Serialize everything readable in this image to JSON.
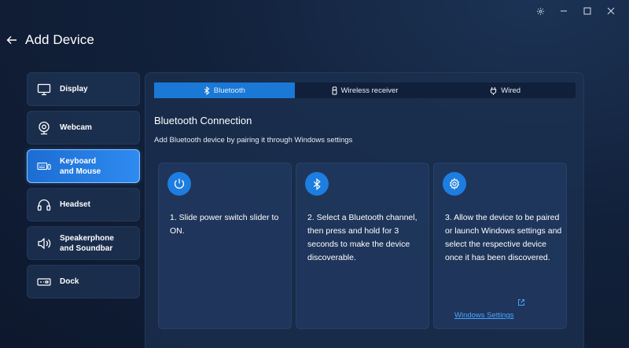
{
  "window": {
    "settings_icon": "gear-icon",
    "minimize_icon": "minimize-icon",
    "maximize_icon": "maximize-icon",
    "close_icon": "close-icon"
  },
  "header": {
    "title": "Add Device",
    "back_icon": "arrow-left-icon"
  },
  "sidebar": {
    "items": [
      {
        "label": "Display",
        "icon": "monitor-icon",
        "active": false
      },
      {
        "label": "Webcam",
        "icon": "webcam-icon",
        "active": false
      },
      {
        "label": "Keyboard\nand Mouse",
        "icon": "keyboard-mouse-icon",
        "active": true
      },
      {
        "label": "Headset",
        "icon": "headset-icon",
        "active": false
      },
      {
        "label": "Speakerphone\nand Soundbar",
        "icon": "speaker-icon",
        "active": false
      },
      {
        "label": "Dock",
        "icon": "dock-icon",
        "active": false
      }
    ]
  },
  "tabs": [
    {
      "label": "Bluetooth",
      "icon": "bluetooth-icon",
      "active": true
    },
    {
      "label": "Wireless receiver",
      "icon": "usb-receiver-icon",
      "active": false
    },
    {
      "label": "Wired",
      "icon": "plug-icon",
      "active": false
    }
  ],
  "main": {
    "section_title": "Bluetooth Connection",
    "section_desc": "Add Bluetooth device by pairing it through Windows settings",
    "steps": [
      {
        "icon": "power-icon",
        "text": "1.  Slide power switch slider to ON."
      },
      {
        "icon": "bluetooth-icon",
        "text": "2.  Select a Bluetooth channel, then press and hold for 3 seconds to make the device discoverable."
      },
      {
        "icon": "gear-icon",
        "text": "3.  Allow the device to be paired or launch Windows settings and select the respective device once it has been discovered.",
        "link": "Windows Settings",
        "link_icon": "external-link-icon"
      }
    ]
  },
  "colors": {
    "accent": "#1a78d6",
    "link": "#4aa5ff",
    "background": "#12213b"
  }
}
